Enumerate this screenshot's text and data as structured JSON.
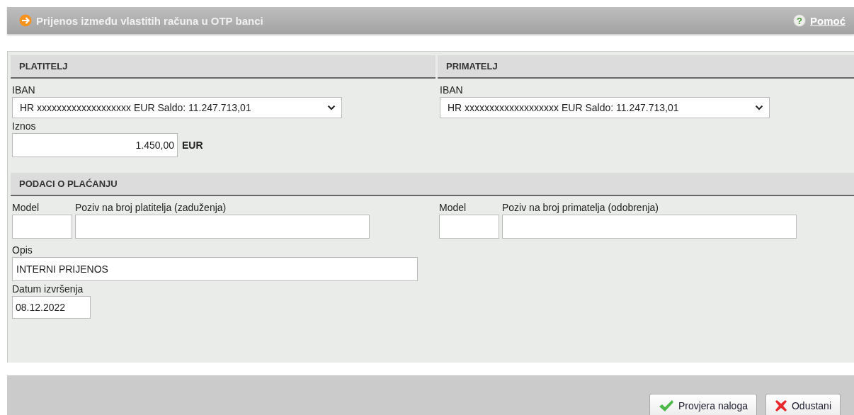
{
  "header": {
    "title": "Prijenos između vlastitih računa u OTP banci",
    "help_icon": "?",
    "help_link": "Pomoć"
  },
  "payer": {
    "heading": "PLATITELJ",
    "iban_label": "IBAN",
    "iban_value": "HR xxxxxxxxxxxxxxxxxxx EUR Saldo: 11.247.713,01",
    "amount_label": "Iznos",
    "amount_value": "1.450,00",
    "currency": "EUR"
  },
  "payee": {
    "heading": "PRIMATELJ",
    "iban_label": "IBAN",
    "iban_value": "HR xxxxxxxxxxxxxxxxxxx EUR Saldo: 11.247.713,01"
  },
  "payment_details": {
    "heading": "PODACI O PLAĆANJU",
    "references": [
      {
        "model_label": "Model",
        "reference_label": "Poziv na broj platitelja (zaduženja)"
      },
      {
        "model_label": "Model",
        "reference_label": "Poziv na broj primatelja (odobrenja)"
      }
    ],
    "description_label": "Opis",
    "description_value": "INTERNI PRIJENOS",
    "date_label": "Datum izvršenja",
    "date_value": "08.12.2022"
  },
  "buttons": [
    {
      "label": "Provjera naloga",
      "kind": "confirm"
    },
    {
      "label": "Odustani",
      "kind": "cancel"
    }
  ]
}
